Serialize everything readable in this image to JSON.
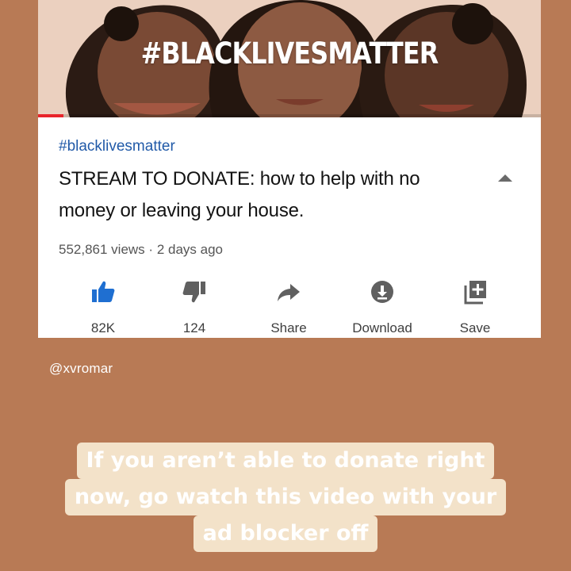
{
  "thumbnail": {
    "overlay_text": "#BLACKLIVESMATTER",
    "progress": 0.05,
    "progress_color": "#e8242b"
  },
  "video": {
    "hashtag": "#blacklivesmatter",
    "title": "STREAM TO DONATE: how to help with no money or leaving your house.",
    "views": "552,861 views",
    "separator": "·",
    "age": "2 days ago",
    "hashtag_color": "#215aa8"
  },
  "actions": [
    {
      "icon": "thumbs-up-icon",
      "label": "82K",
      "color": "#1f6fd1",
      "active": true
    },
    {
      "icon": "thumbs-down-icon",
      "label": "124",
      "color": "#606060",
      "active": false
    },
    {
      "icon": "share-icon",
      "label": "Share",
      "color": "#606060",
      "active": false
    },
    {
      "icon": "download-icon",
      "label": "Download",
      "color": "#606060",
      "active": false
    },
    {
      "icon": "save-playlist-icon",
      "label": "Save",
      "color": "#606060",
      "active": false
    }
  ],
  "story": {
    "handle": "@xvromar",
    "caption_lines": [
      "If you aren’t able to donate right",
      "now, go watch this video with your",
      "ad blocker off"
    ],
    "background_color": "#b87a55",
    "caption_bg_color": "#f3e2c9"
  }
}
